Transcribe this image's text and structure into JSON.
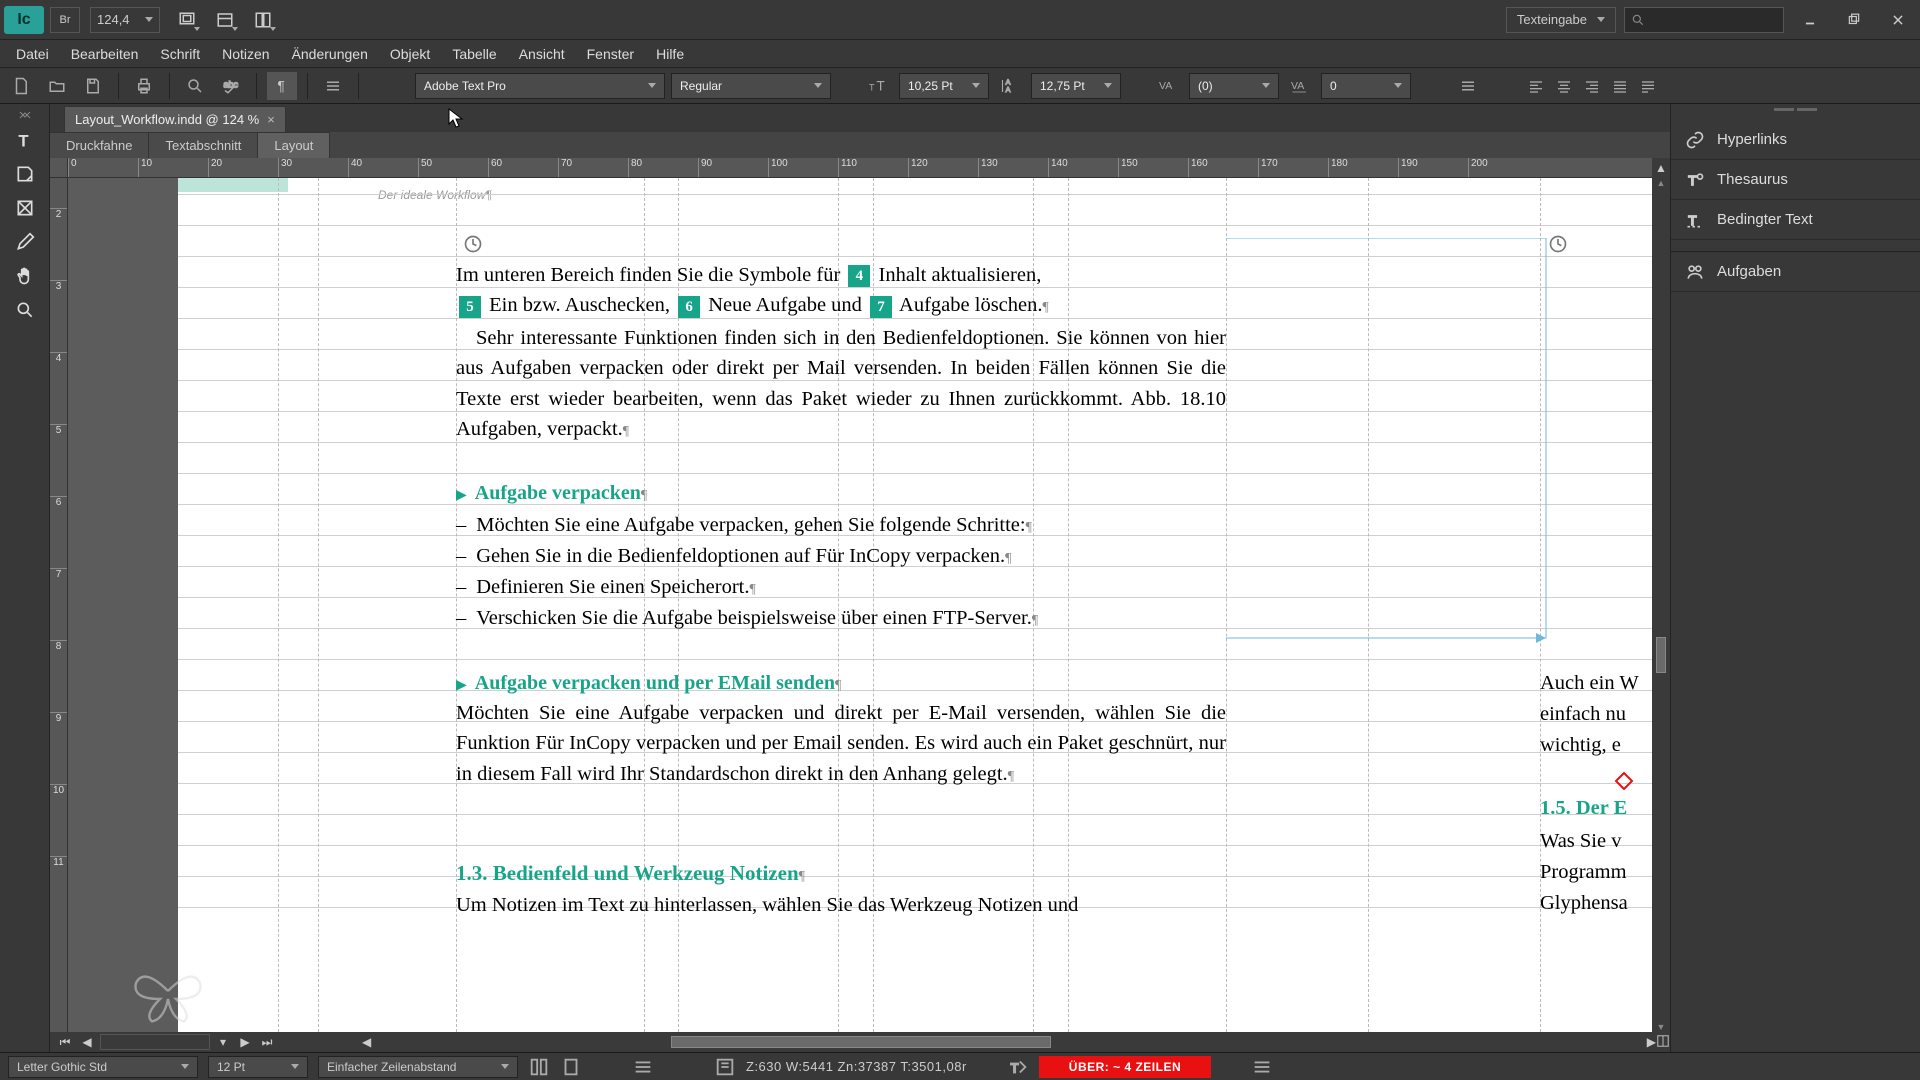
{
  "app": {
    "logo": "Ic",
    "bridge": "Br",
    "zoom": "124,4"
  },
  "arrange_label": "Texteingabe",
  "window": {
    "min": "–",
    "max": "❐",
    "close": "✕"
  },
  "menu": [
    "Datei",
    "Bearbeiten",
    "Schrift",
    "Notizen",
    "Änderungen",
    "Objekt",
    "Tabelle",
    "Ansicht",
    "Fenster",
    "Hilfe"
  ],
  "ctrl": {
    "font": "Adobe Text Pro",
    "style": "Regular",
    "size": "10,25 Pt",
    "leading": "12,75 Pt",
    "kerning": "(0)",
    "tracking": "0"
  },
  "doc_tab": "Layout_Workflow.indd @ 124 %",
  "view_tabs": {
    "druck": "Druckfahne",
    "text": "Textabschnitt",
    "layout": "Layout"
  },
  "ruler_h": [
    "0",
    "10",
    "20",
    "30",
    "40",
    "50",
    "60",
    "70",
    "80",
    "90",
    "100",
    "110",
    "120",
    "130",
    "140",
    "150",
    "160",
    "170",
    "180",
    "190",
    "200"
  ],
  "ruler_v": [
    "2",
    "3",
    "4",
    "5",
    "6",
    "7",
    "8",
    "9",
    "10",
    "11"
  ],
  "header_text": "Der ideale Workflow",
  "body": {
    "p1a": "Im unteren Bereich finden Sie die Symbole für ",
    "m4": "4",
    "p1b": " Inhalt aktualisieren, ",
    "m5": "5",
    "p1c": " Ein bzw. Auschecken, ",
    "m6": "6",
    "p1d": " Neue Aufgabe und ",
    "m7": "7",
    "p1e": " Aufgabe löschen.",
    "p2": "Sehr interessante Funktionen finden sich in den Bedienfeldoptionen. Sie können von hier aus Aufgaben verpacken oder direkt per Mail versenden. In beiden Fällen können Sie die Texte erst wieder bearbeiten, wenn das Paket wieder zu Ihnen zurückkommt. Abb. 18.10 Aufgaben, verpackt.",
    "h1": "Aufgabe verpacken",
    "li1": "Möchten Sie eine Aufgabe verpacken, gehen Sie folgende Schritte:",
    "li2": "Gehen Sie in die Bedienfeldoptionen auf Für InCopy verpacken.",
    "li3": "Definieren Sie einen Speicherort.",
    "li4": "Verschicken Sie die Aufgabe beispielsweise über einen FTP-Server.",
    "h2": "Aufgabe verpacken und per EMail senden",
    "p3": "Möchten Sie eine Aufgabe verpacken und direkt per E-Mail versenden, wählen Sie die Funktion Für InCopy verpacken und per Email senden. Es wird auch ein Paket geschnürt, nur in diesem Fall wird Ihr Standardschon direkt in den Anhang gelegt.",
    "h3": "1.3.  Bedienfeld und Werkzeug Notizen",
    "p4": "Um Notizen im Text zu hinterlassen, wählen Sie das Werkzeug Notizen und"
  },
  "side": {
    "s1": "Auch ein W",
    "s2": "einfach nu",
    "s3": "wichtig, e",
    "sh": "1.5.  Der E",
    "s4": "Was Sie v",
    "s5": "Programm",
    "s6": "Glyphensa"
  },
  "panels": [
    "Hyperlinks",
    "Thesaurus",
    "Bedingter Text",
    "Aufgaben"
  ],
  "bottom": {
    "page_ico": "⫶",
    "prev": "◀",
    "next": "▶"
  },
  "status": {
    "font2": "Letter Gothic Std",
    "size2": "12 Pt",
    "leading2": "Einfacher Zeilenabstand",
    "coords": "Z:630    W:5441    Zn:37387   T:3501,08r",
    "copyfit": "ÜBER:  ~ 4 ZEILEN"
  }
}
